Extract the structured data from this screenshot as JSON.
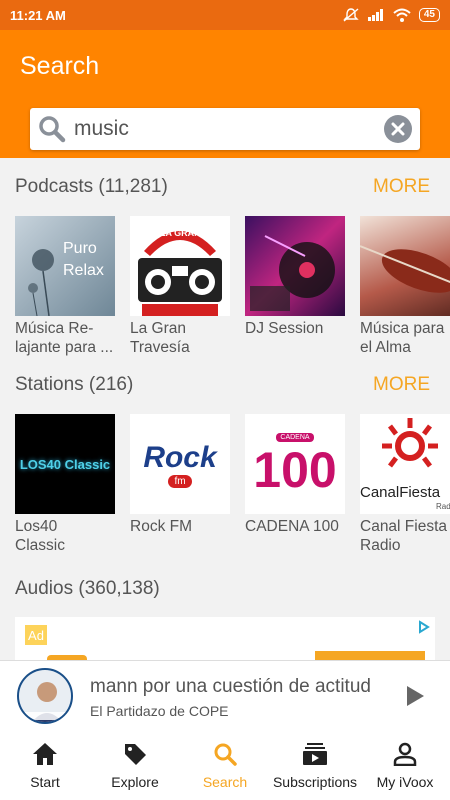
{
  "status_bar": {
    "time": "11:21 AM",
    "battery": "45"
  },
  "header": {
    "title": "Search"
  },
  "search": {
    "value": "music"
  },
  "podcasts": {
    "title": "Podcasts (11,281)",
    "more_label": "MORE",
    "items": [
      {
        "label": "Música Re-\nlajante para ...",
        "thumb_text": "Puro\nRelax"
      },
      {
        "label": "La Gran\nTravesía",
        "thumb_text": "LA GRAN"
      },
      {
        "label": "DJ Session",
        "thumb_text": ""
      },
      {
        "label": " Música para\nel Alma",
        "thumb_text": ""
      }
    ]
  },
  "stations": {
    "title": "Stations (216)",
    "more_label": "MORE",
    "items": [
      {
        "label": "Los40\nClassic",
        "thumb_text": "LOS40 Classic"
      },
      {
        "label": "Rock FM",
        "thumb_text": "Rock",
        "thumb_sub": "fm"
      },
      {
        "label": "CADENA 100",
        "thumb_text": "100",
        "thumb_sub": "CADENA"
      },
      {
        "label": "Canal Fiesta\nRadio",
        "thumb_text": "CanalFiesta",
        "thumb_sub": "Rad"
      }
    ]
  },
  "audios": {
    "title": "Audios (360,138)"
  },
  "ad": {
    "badge": "Ad"
  },
  "player": {
    "title": "mann por una cuestión de actitud",
    "subtitle": "El Partidazo de COPE"
  },
  "nav": {
    "items": [
      {
        "label": "Start",
        "icon": "home-icon"
      },
      {
        "label": "Explore",
        "icon": "tag-icon"
      },
      {
        "label": "Search",
        "icon": "search-icon"
      },
      {
        "label": "Subscriptions",
        "icon": "subscriptions-icon"
      },
      {
        "label": "My iVoox",
        "icon": "person-icon"
      }
    ]
  },
  "colors": {
    "header": "#ff8400",
    "statusbar": "#ea6a10",
    "accent": "#f5a623"
  }
}
